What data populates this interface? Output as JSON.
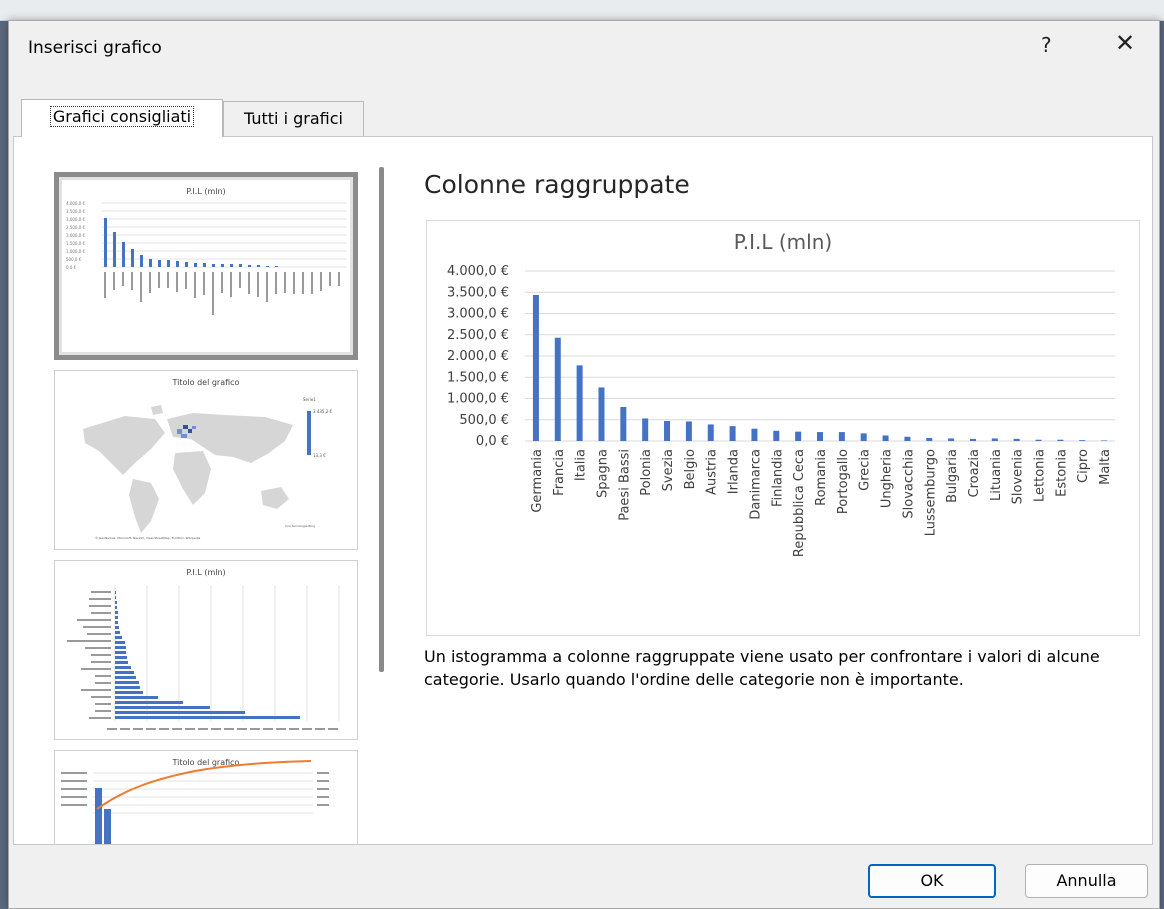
{
  "dialog": {
    "title": "Inserisci grafico",
    "help_label": "?",
    "close_label": "✕",
    "tabs": [
      {
        "label": "Grafici consigliati",
        "active": true
      },
      {
        "label": "Tutti i grafici",
        "active": false
      }
    ],
    "ok_label": "OK",
    "cancel_label": "Annulla"
  },
  "thumbnails": [
    {
      "title": "P.I.L (mln)"
    },
    {
      "title": "Titolo del grafico",
      "legend_title": "Serie1",
      "legend_max": "3.435,2 €",
      "legend_min": "13,3 €",
      "footer": "Con tecnologia Bing",
      "footer_long": "© GeoNames, Microsoft, Navinfo, OpenStreetMap, TomTom, Wikipedia"
    },
    {
      "title": "P.I.L (mln)"
    },
    {
      "title": "Titolo del grafico"
    }
  ],
  "preview": {
    "chart_type": "Colonne raggruppate",
    "description": "Un istogramma a colonne raggruppate viene usato per confrontare i valori di alcune categorie. Usarlo quando l'ordine delle categorie non è importante."
  },
  "colors": {
    "bar": "#4472c4",
    "line": "#ed7d31"
  },
  "chart_data": {
    "type": "bar",
    "title": "P.I.L (mln)",
    "categories": [
      "Germania",
      "Francia",
      "Italia",
      "Spagna",
      "Paesi Bassi",
      "Polonia",
      "Svezia",
      "Belgio",
      "Austria",
      "Irlanda",
      "Danimarca",
      "Finlandia",
      "Repubblica Ceca",
      "Romania",
      "Portogallo",
      "Grecia",
      "Ungheria",
      "Slovacchia",
      "Lussemburgo",
      "Bulgaria",
      "Croazia",
      "Lituania",
      "Slovenia",
      "Lettonia",
      "Estonia",
      "Cipro",
      "Malta"
    ],
    "values": [
      3435.2,
      2430,
      1780,
      1260,
      800,
      530,
      470,
      460,
      390,
      350,
      290,
      240,
      220,
      210,
      210,
      180,
      130,
      100,
      70,
      60,
      50,
      60,
      50,
      30,
      30,
      20,
      13.3
    ],
    "ylim": [
      0,
      4000
    ],
    "yticks": [
      "0,0 €",
      "500,0 €",
      "1.000,0 €",
      "1.500,0 €",
      "2.000,0 €",
      "2.500,0 €",
      "3.000,0 €",
      "3.500,0 €",
      "4.000,0 €"
    ],
    "grid": true
  }
}
